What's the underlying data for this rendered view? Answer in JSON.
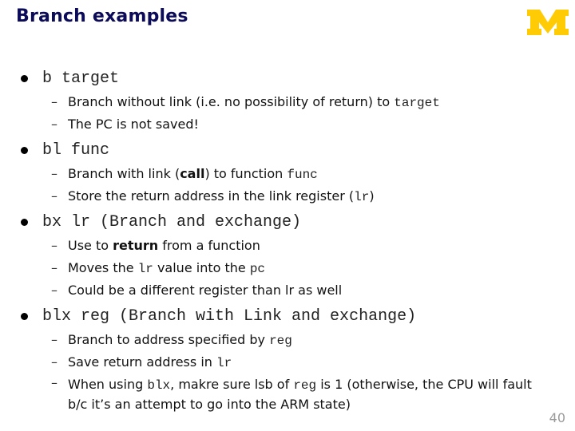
{
  "slide": {
    "title": "Branch examples",
    "logo": "university-of-michigan-block-m",
    "logo_color": "#FFCB05",
    "title_color": "#0B0B5A",
    "page_number": "40"
  },
  "bullets": [
    {
      "code": "b target",
      "subs": [
        {
          "parts": [
            {
              "t": "Branch without link (i.e. no possibility of return) to "
            },
            {
              "t": "target",
              "mono": true
            }
          ]
        },
        {
          "parts": [
            {
              "t": "The PC is not saved!"
            }
          ]
        }
      ]
    },
    {
      "code": "bl func",
      "subs": [
        {
          "parts": [
            {
              "t": "Branch with link ("
            },
            {
              "t": "call",
              "bold": true
            },
            {
              "t": ") to function "
            },
            {
              "t": "func",
              "mono": true
            }
          ]
        },
        {
          "parts": [
            {
              "t": "Store the return address in the link register ("
            },
            {
              "t": "lr",
              "mono": true
            },
            {
              "t": ")"
            }
          ]
        }
      ]
    },
    {
      "code": "bx lr (Branch and exchange)",
      "subs": [
        {
          "parts": [
            {
              "t": "Use to "
            },
            {
              "t": "return",
              "bold": true
            },
            {
              "t": " from a function"
            }
          ]
        },
        {
          "parts": [
            {
              "t": "Moves the "
            },
            {
              "t": "lr",
              "mono": true
            },
            {
              "t": " value into the "
            },
            {
              "t": "pc",
              "mono": true
            }
          ]
        },
        {
          "parts": [
            {
              "t": "Could be a different register than lr as well"
            }
          ]
        }
      ]
    },
    {
      "code": "blx reg (Branch with Link and exchange)",
      "subs": [
        {
          "parts": [
            {
              "t": "Branch to address specified by "
            },
            {
              "t": "reg",
              "mono": true
            }
          ]
        },
        {
          "parts": [
            {
              "t": "Save return address in "
            },
            {
              "t": "lr",
              "mono": true
            }
          ]
        },
        {
          "multi": true,
          "parts": [
            {
              "t": "When using "
            },
            {
              "t": "blx",
              "mono": true
            },
            {
              "t": ", makre sure lsb of "
            },
            {
              "t": "reg",
              "mono": true
            },
            {
              "t": " is 1 (otherwise, the CPU will fault b/c it’s an attempt to go into the ARM state)"
            }
          ]
        }
      ]
    }
  ]
}
